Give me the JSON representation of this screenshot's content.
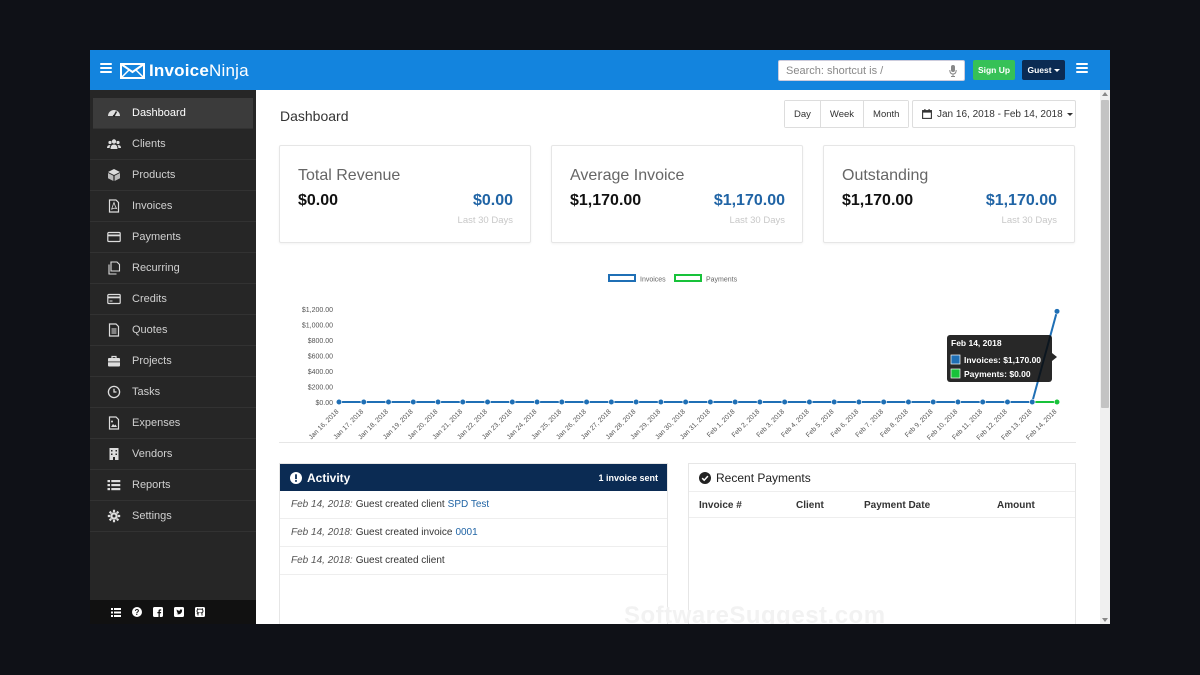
{
  "header": {
    "logo_text_bold": "Invoice",
    "logo_text_light": "Ninja",
    "search_placeholder": "Search: shortcut is /",
    "signup_label": "Sign Up",
    "guest_label": "Guest",
    "brand_color": "#1384de"
  },
  "sidebar": {
    "items": [
      {
        "label": "Dashboard",
        "icon": "dashboard-icon",
        "active": true
      },
      {
        "label": "Clients",
        "icon": "users-icon"
      },
      {
        "label": "Products",
        "icon": "cube-icon"
      },
      {
        "label": "Invoices",
        "icon": "file-pdf-icon"
      },
      {
        "label": "Payments",
        "icon": "credit-card-icon"
      },
      {
        "label": "Recurring",
        "icon": "files-icon"
      },
      {
        "label": "Credits",
        "icon": "card-icon"
      },
      {
        "label": "Quotes",
        "icon": "document-icon"
      },
      {
        "label": "Projects",
        "icon": "briefcase-icon"
      },
      {
        "label": "Tasks",
        "icon": "clock-icon"
      },
      {
        "label": "Expenses",
        "icon": "image-file-icon"
      },
      {
        "label": "Vendors",
        "icon": "building-icon"
      },
      {
        "label": "Reports",
        "icon": "list-icon"
      },
      {
        "label": "Settings",
        "icon": "gear-icon"
      }
    ],
    "footer_icons": [
      "list-icon",
      "help-icon",
      "facebook-icon",
      "twitter-icon",
      "github-icon"
    ]
  },
  "main": {
    "title": "Dashboard",
    "range_buttons": [
      "Day",
      "Week",
      "Month"
    ],
    "date_range": "Jan 16, 2018 - Feb 14, 2018",
    "stats": [
      {
        "title": "Total Revenue",
        "value": "$0.00",
        "accent": "$0.00",
        "period": "Last 30 Days"
      },
      {
        "title": "Average Invoice",
        "value": "$1,170.00",
        "accent": "$1,170.00",
        "period": "Last 30 Days"
      },
      {
        "title": "Outstanding",
        "value": "$1,170.00",
        "accent": "$1,170.00",
        "period": "Last 30 Days"
      }
    ],
    "activity": {
      "title": "Activity",
      "badge": "1 invoice sent",
      "rows": [
        {
          "date": "Feb 14, 2018:",
          "text": "Guest created client",
          "link": "SPD Test"
        },
        {
          "date": "Feb 14, 2018:",
          "text": "Guest created invoice",
          "link": "0001"
        },
        {
          "date": "Feb 14, 2018:",
          "text": "Guest created client",
          "link": ""
        }
      ]
    },
    "payments": {
      "title": "Recent Payments",
      "columns": [
        "Invoice #",
        "Client",
        "Payment Date",
        "Amount"
      ]
    },
    "watermark": "SoftwareSuggest.com"
  },
  "chart_data": {
    "type": "line",
    "x": [
      "Jan 16, 2018",
      "Jan 17, 2018",
      "Jan 18, 2018",
      "Jan 19, 2018",
      "Jan 20, 2018",
      "Jan 21, 2018",
      "Jan 22, 2018",
      "Jan 23, 2018",
      "Jan 24, 2018",
      "Jan 25, 2018",
      "Jan 26, 2018",
      "Jan 27, 2018",
      "Jan 28, 2018",
      "Jan 29, 2018",
      "Jan 30, 2018",
      "Jan 31, 2018",
      "Feb 1, 2018",
      "Feb 2, 2018",
      "Feb 3, 2018",
      "Feb 4, 2018",
      "Feb 5, 2018",
      "Feb 6, 2018",
      "Feb 7, 2018",
      "Feb 8, 2018",
      "Feb 9, 2018",
      "Feb 10, 2018",
      "Feb 11, 2018",
      "Feb 12, 2018",
      "Feb 13, 2018",
      "Feb 14, 2018"
    ],
    "series": [
      {
        "name": "Invoices",
        "color": "#1f6fb5",
        "values": [
          0,
          0,
          0,
          0,
          0,
          0,
          0,
          0,
          0,
          0,
          0,
          0,
          0,
          0,
          0,
          0,
          0,
          0,
          0,
          0,
          0,
          0,
          0,
          0,
          0,
          0,
          0,
          0,
          0,
          1170
        ]
      },
      {
        "name": "Payments",
        "color": "#18c23a",
        "values": [
          0,
          0,
          0,
          0,
          0,
          0,
          0,
          0,
          0,
          0,
          0,
          0,
          0,
          0,
          0,
          0,
          0,
          0,
          0,
          0,
          0,
          0,
          0,
          0,
          0,
          0,
          0,
          0,
          0,
          0
        ]
      }
    ],
    "yticks": [
      "$0.00",
      "$200.00",
      "$400.00",
      "$600.00",
      "$800.00",
      "$1,000.00",
      "$1,200.00"
    ],
    "ylim": [
      0,
      1200
    ],
    "legend": "top-center",
    "tooltip": {
      "title": "Feb 14, 2018",
      "lines": [
        "Invoices: $1,170.00",
        "Payments: $0.00"
      ]
    }
  }
}
